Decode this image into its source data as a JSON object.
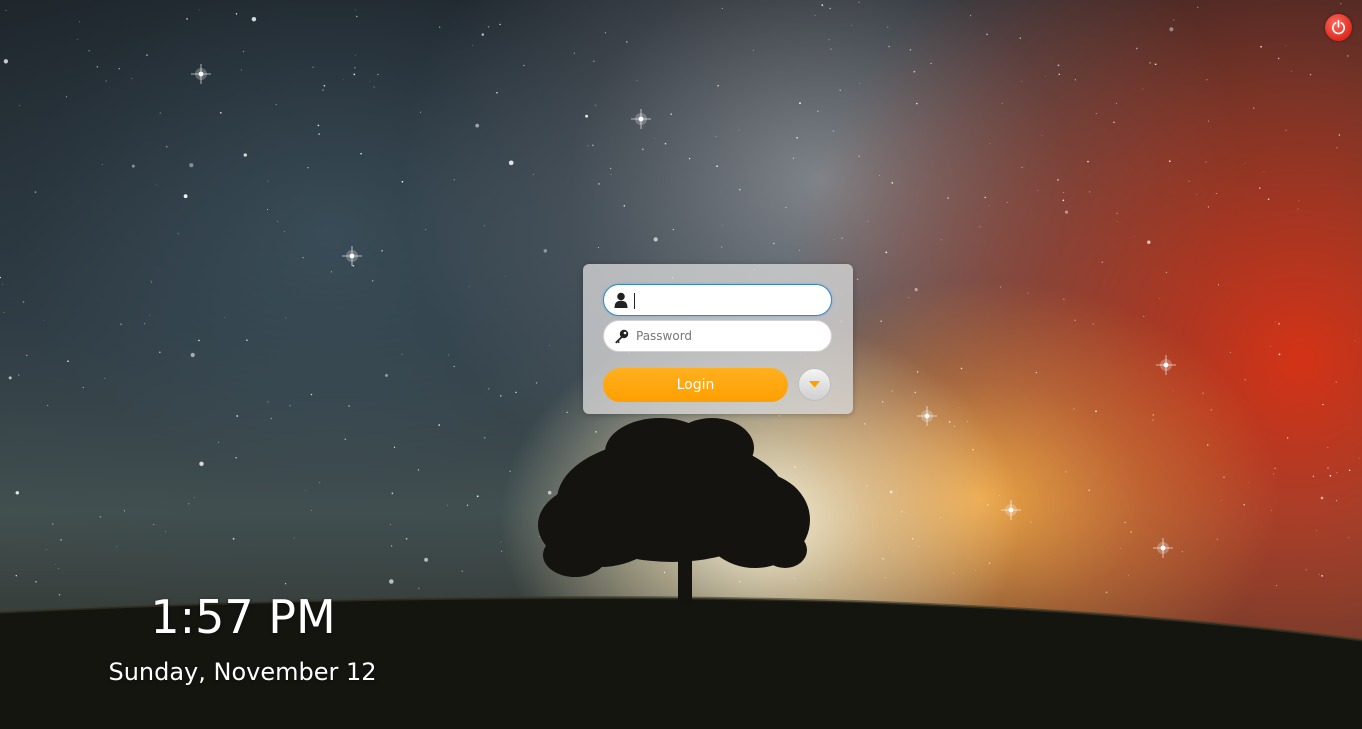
{
  "login": {
    "username": {
      "value": "",
      "placeholder": "",
      "icon": "user-icon"
    },
    "password": {
      "value": "",
      "placeholder": "Password",
      "icon": "key-icon"
    },
    "login_label": "Login",
    "options_icon": "chevron-down-icon"
  },
  "power": {
    "icon": "power-icon"
  },
  "status": {
    "time": "1:57 PM",
    "date": "Sunday, November 12"
  },
  "colors": {
    "accent": "#FFA200",
    "power": "#E53A2E",
    "focus_border": "#3B86C6",
    "panel_bg": "#D7D7D7"
  }
}
